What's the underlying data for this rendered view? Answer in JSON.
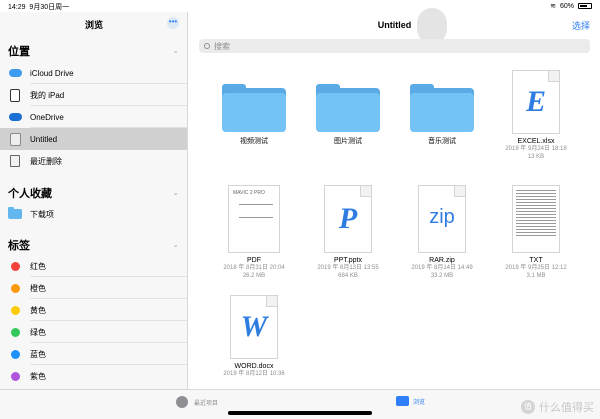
{
  "status_bar": {
    "time": "14:29",
    "date": "9月30日周一",
    "battery": "60%"
  },
  "sidebar": {
    "title": "浏览",
    "more": "•••",
    "locations_header": "位置",
    "locations": [
      {
        "label": "iCloud Drive",
        "icon": "icloud-icon"
      },
      {
        "label": "我的 iPad",
        "icon": "ipad-icon"
      },
      {
        "label": "OneDrive",
        "icon": "cloud-icon"
      },
      {
        "label": "Untitled",
        "icon": "usb-drive-icon"
      },
      {
        "label": "最近删除",
        "icon": "trash-icon"
      }
    ],
    "favorites_header": "个人收藏",
    "favorites": [
      {
        "label": "下载项",
        "icon": "folder-icon"
      }
    ],
    "tags_header": "标签",
    "tags": [
      {
        "label": "红色",
        "color": "#f3423c"
      },
      {
        "label": "橙色",
        "color": "#fa9a0a"
      },
      {
        "label": "黄色",
        "color": "#fccc0a"
      },
      {
        "label": "绿色",
        "color": "#33c759"
      },
      {
        "label": "蓝色",
        "color": "#1f8ff9"
      },
      {
        "label": "紫色",
        "color": "#af52de"
      }
    ]
  },
  "main": {
    "title": "Untitled",
    "select_label": "选择",
    "search_placeholder": "搜索",
    "items": [
      {
        "name": "视频测试",
        "kind": "folder"
      },
      {
        "name": "图片测试",
        "kind": "folder"
      },
      {
        "name": "音乐测试",
        "kind": "folder"
      },
      {
        "name": "EXCEL.xlsx",
        "kind": "doc",
        "glyph": "E",
        "date": "2019 年 9月24日 18:18",
        "size": "13 KB"
      },
      {
        "name": "PDF",
        "kind": "pdf",
        "thumb_text": "MAVIC 2 PRO",
        "date": "2018 年 8月31日 20:04",
        "size": "26.2 MB"
      },
      {
        "name": "PPT.pptx",
        "kind": "doc",
        "glyph": "P",
        "date": "2019 年 8月13日 13:55",
        "size": "684 KB"
      },
      {
        "name": "RAR.zip",
        "kind": "doc",
        "glyph": "zip",
        "date": "2019 年 8月14日 14:49",
        "size": "33.2 MB"
      },
      {
        "name": "TXT",
        "kind": "txt",
        "date": "2019 年 9月25日 12:12",
        "size": "3.1 MB"
      },
      {
        "name": "WORD.docx",
        "kind": "doc",
        "glyph": "W",
        "date": "2019 年 8月12日 10:36",
        "size": ""
      }
    ]
  },
  "tabbar": {
    "recents": "最近项目",
    "browse": "浏览"
  },
  "watermark": {
    "text": "什么值得买",
    "badge": "值"
  }
}
